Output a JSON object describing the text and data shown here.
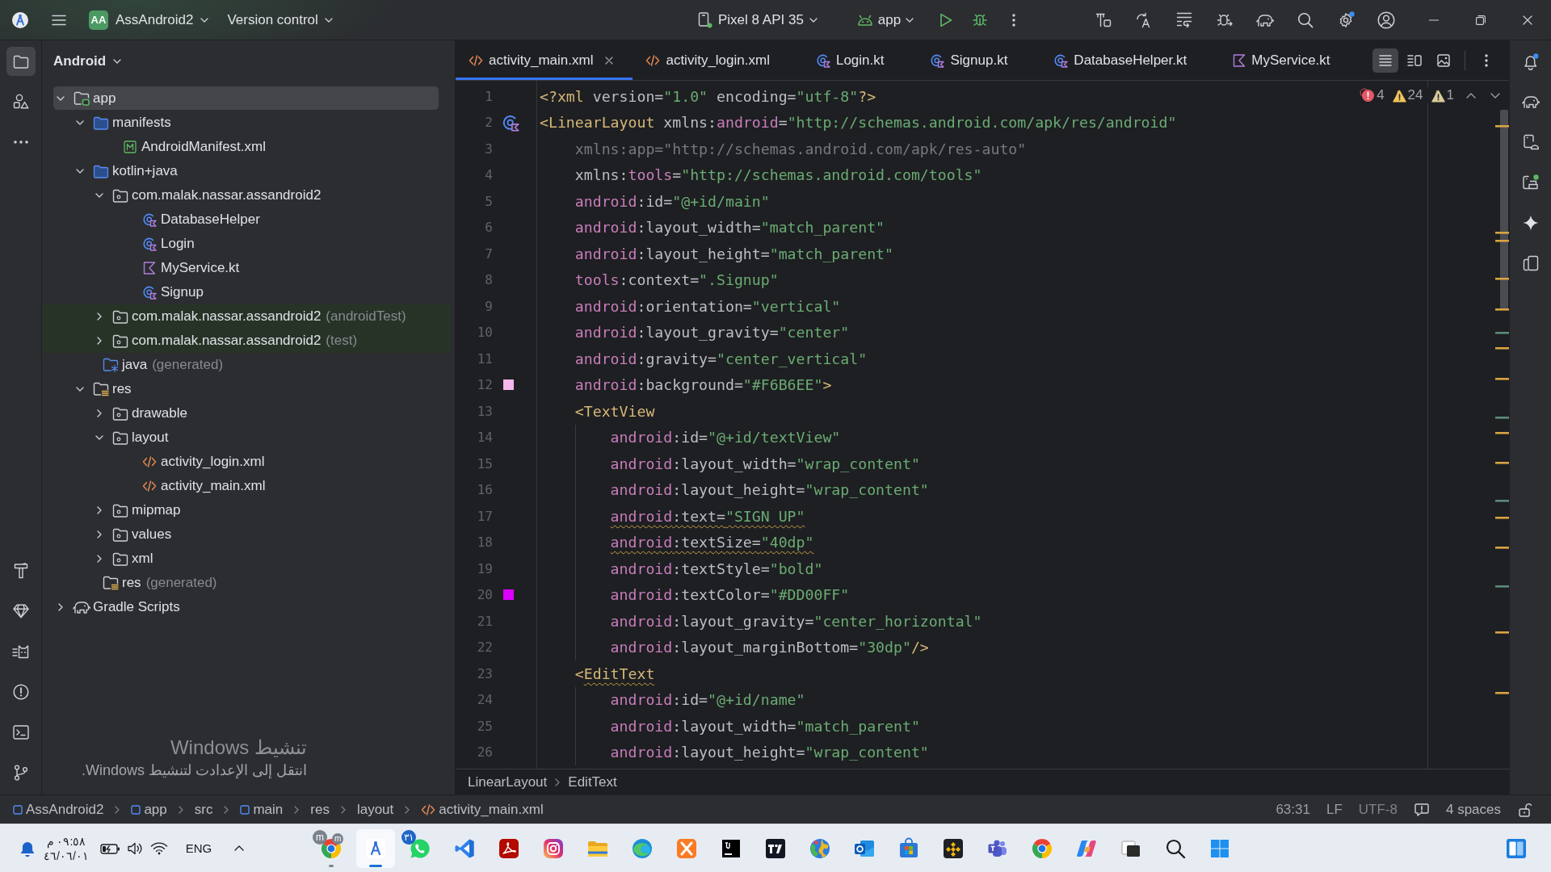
{
  "toolbar": {
    "project_badge": "AA",
    "project": "AssAndroid2",
    "vcs": "Version control",
    "device": "Pixel 8 API 35",
    "run_config": "app"
  },
  "tool_window": {
    "title": "Android"
  },
  "project_tree": [
    {
      "label": "app",
      "kind": "module",
      "expanded": true,
      "selected": true,
      "children": [
        {
          "label": "manifests",
          "kind": "folder",
          "expanded": true,
          "selected": false,
          "children": [
            {
              "label": "AndroidManifest.xml",
              "kind": "manifest",
              "selected": false
            }
          ]
        },
        {
          "label": "kotlin+java",
          "kind": "folder",
          "expanded": true,
          "selected": false,
          "children": [
            {
              "label": "com.malak.nassar.assandroid2",
              "kind": "package",
              "expanded": true,
              "selected": false,
              "children": [
                {
                  "label": "DatabaseHelper",
                  "kind": "class",
                  "selected": false
                },
                {
                  "label": "Login",
                  "kind": "class",
                  "selected": false
                },
                {
                  "label": "MyService.kt",
                  "kind": "kotlin",
                  "selected": false
                },
                {
                  "label": "Signup",
                  "kind": "class",
                  "selected": false
                }
              ]
            },
            {
              "label": "com.malak.nassar.assandroid2",
              "suffix": "(androidTest)",
              "kind": "test-package",
              "expanded": false,
              "selected": false
            },
            {
              "label": "com.malak.nassar.assandroid2",
              "suffix": "(test)",
              "kind": "test-package",
              "expanded": false,
              "selected": false
            }
          ]
        },
        {
          "label": "java",
          "suffix": "(generated)",
          "kind": "generated",
          "selected": false
        },
        {
          "label": "res",
          "kind": "resources",
          "expanded": true,
          "selected": false,
          "children": [
            {
              "label": "drawable",
              "kind": "package",
              "expanded": false,
              "selected": false
            },
            {
              "label": "layout",
              "kind": "package",
              "expanded": true,
              "selected": false,
              "children": [
                {
                  "label": "activity_login.xml",
                  "kind": "layout",
                  "selected": false
                },
                {
                  "label": "activity_main.xml",
                  "kind": "layout",
                  "selected": false
                }
              ]
            },
            {
              "label": "mipmap",
              "kind": "package",
              "expanded": false,
              "selected": false
            },
            {
              "label": "values",
              "kind": "package",
              "expanded": false,
              "selected": false
            },
            {
              "label": "xml",
              "kind": "package",
              "expanded": false,
              "selected": false
            }
          ]
        },
        {
          "label": "res",
          "suffix": "(generated)",
          "kind": "resources",
          "selected": false
        }
      ]
    },
    {
      "label": "Gradle Scripts",
      "kind": "gradle",
      "expanded": false,
      "selected": false
    }
  ],
  "editor_tabs": [
    {
      "label": "activity_main.xml",
      "kind": "xml",
      "selected": true
    },
    {
      "label": "activity_login.xml",
      "kind": "xml",
      "selected": false
    },
    {
      "label": "Login.kt",
      "kind": "class",
      "selected": false
    },
    {
      "label": "Signup.kt",
      "kind": "class",
      "selected": false
    },
    {
      "label": "DatabaseHelper.kt",
      "kind": "class",
      "selected": false
    },
    {
      "label": "MyService.kt",
      "kind": "kotlin",
      "selected": false
    }
  ],
  "view_modes": [
    {
      "kind": "code",
      "selected": true
    },
    {
      "kind": "split",
      "selected": false
    },
    {
      "kind": "design",
      "selected": false
    }
  ],
  "inspections": [
    {
      "kind": "error",
      "count": "4"
    },
    {
      "kind": "warning",
      "count": "24"
    },
    {
      "kind": "weak",
      "count": "1"
    }
  ],
  "code_lines": [
    {
      "number": "1",
      "warning": false,
      "tokens": [
        {
          "kind": "tag",
          "text": "<?xml"
        },
        {
          "kind": "attr",
          "text": " version="
        },
        {
          "kind": "value",
          "text": "\"1.0\""
        },
        {
          "kind": "attr",
          "text": " encoding="
        },
        {
          "kind": "value",
          "text": "\"utf-8\""
        },
        {
          "kind": "tag",
          "text": "?>"
        }
      ]
    },
    {
      "number": "2",
      "warning": false,
      "gutter_icon": true,
      "tokens": [
        {
          "kind": "tag",
          "text": "<LinearLayout"
        },
        {
          "kind": "attr",
          "text": " xmlns:"
        },
        {
          "kind": "ns",
          "text": "android"
        },
        {
          "kind": "attr",
          "text": "="
        },
        {
          "kind": "value",
          "text": "\"http://schemas.android.com/apk/res/android\""
        }
      ],
      "children": [
        {
          "number": "3",
          "warning": false,
          "tokens": [
            {
              "kind": "unused",
              "text": "xmlns:app=\"http://schemas.android.com/apk/res-auto\""
            }
          ]
        },
        {
          "number": "4",
          "warning": false,
          "tokens": [
            {
              "kind": "attr",
              "text": "xmlns:"
            },
            {
              "kind": "ns",
              "text": "tools"
            },
            {
              "kind": "attr",
              "text": "="
            },
            {
              "kind": "value",
              "text": "\"http://schemas.android.com/tools\""
            }
          ]
        },
        {
          "number": "5",
          "warning": false,
          "tokens": [
            {
              "kind": "ns",
              "text": "android"
            },
            {
              "kind": "attr",
              "text": ":id="
            },
            {
              "kind": "value",
              "text": "\"@+id/main\""
            }
          ]
        },
        {
          "number": "6",
          "warning": false,
          "tokens": [
            {
              "kind": "ns",
              "text": "android"
            },
            {
              "kind": "attr",
              "text": ":layout_width="
            },
            {
              "kind": "value",
              "text": "\"match_parent\""
            }
          ]
        },
        {
          "number": "7",
          "warning": false,
          "tokens": [
            {
              "kind": "ns",
              "text": "android"
            },
            {
              "kind": "attr",
              "text": ":layout_height="
            },
            {
              "kind": "value",
              "text": "\"match_parent\""
            }
          ]
        },
        {
          "number": "8",
          "warning": false,
          "tokens": [
            {
              "kind": "ns",
              "text": "tools"
            },
            {
              "kind": "attr",
              "text": ":context="
            },
            {
              "kind": "value",
              "text": "\".Signup\""
            }
          ]
        },
        {
          "number": "9",
          "warning": false,
          "tokens": [
            {
              "kind": "ns",
              "text": "android"
            },
            {
              "kind": "attr",
              "text": ":orientation="
            },
            {
              "kind": "value",
              "text": "\"vertical\""
            }
          ]
        },
        {
          "number": "10",
          "warning": false,
          "tokens": [
            {
              "kind": "ns",
              "text": "android"
            },
            {
              "kind": "attr",
              "text": ":layout_gravity="
            },
            {
              "kind": "value",
              "text": "\"center\""
            }
          ]
        },
        {
          "number": "11",
          "warning": false,
          "tokens": [
            {
              "kind": "ns",
              "text": "android"
            },
            {
              "kind": "attr",
              "text": ":gravity="
            },
            {
              "kind": "value",
              "text": "\"center_vertical\""
            }
          ]
        },
        {
          "number": "12",
          "warning": false,
          "color": "#F6B6EE",
          "tokens": [
            {
              "kind": "ns",
              "text": "android"
            },
            {
              "kind": "attr",
              "text": ":background="
            },
            {
              "kind": "value",
              "text": "\"#F6B6EE\""
            },
            {
              "kind": "tag",
              "text": ">"
            }
          ]
        },
        {
          "number": "13",
          "warning": false,
          "tokens": [
            {
              "kind": "tag",
              "text": "<TextView"
            }
          ],
          "children": [
            {
              "number": "14",
              "warning": false,
              "tokens": [
                {
                  "kind": "ns",
                  "text": "android"
                },
                {
                  "kind": "attr",
                  "text": ":id="
                },
                {
                  "kind": "value",
                  "text": "\"@+id/textView\""
                }
              ]
            },
            {
              "number": "15",
              "warning": false,
              "tokens": [
                {
                  "kind": "ns",
                  "text": "android"
                },
                {
                  "kind": "attr",
                  "text": ":layout_width="
                },
                {
                  "kind": "value",
                  "text": "\"wrap_content\""
                }
              ]
            },
            {
              "number": "16",
              "warning": false,
              "tokens": [
                {
                  "kind": "ns",
                  "text": "android"
                },
                {
                  "kind": "attr",
                  "text": ":layout_height="
                },
                {
                  "kind": "value",
                  "text": "\"wrap_content\""
                }
              ]
            },
            {
              "number": "17",
              "warning": true,
              "tokens": [
                {
                  "kind": "ns",
                  "text": "android"
                },
                {
                  "kind": "attr",
                  "text": ":text="
                },
                {
                  "kind": "value",
                  "text": "\"SIGN UP\""
                }
              ]
            },
            {
              "number": "18",
              "warning": true,
              "tokens": [
                {
                  "kind": "ns",
                  "text": "android"
                },
                {
                  "kind": "attr",
                  "text": ":textSize="
                },
                {
                  "kind": "value",
                  "text": "\"40dp\""
                }
              ]
            },
            {
              "number": "19",
              "warning": false,
              "tokens": [
                {
                  "kind": "ns",
                  "text": "android"
                },
                {
                  "kind": "attr",
                  "text": ":textStyle="
                },
                {
                  "kind": "value",
                  "text": "\"bold\""
                }
              ]
            },
            {
              "number": "20",
              "warning": false,
              "color": "#DD00FF",
              "tokens": [
                {
                  "kind": "ns",
                  "text": "android"
                },
                {
                  "kind": "attr",
                  "text": ":textColor="
                },
                {
                  "kind": "value",
                  "text": "\"#DD00FF\""
                }
              ]
            },
            {
              "number": "21",
              "warning": false,
              "tokens": [
                {
                  "kind": "ns",
                  "text": "android"
                },
                {
                  "kind": "attr",
                  "text": ":layout_gravity="
                },
                {
                  "kind": "value",
                  "text": "\"center_horizontal\""
                }
              ]
            },
            {
              "number": "22",
              "warning": false,
              "tokens": [
                {
                  "kind": "ns",
                  "text": "android"
                },
                {
                  "kind": "attr",
                  "text": ":layout_marginBottom="
                },
                {
                  "kind": "value",
                  "text": "\"30dp\""
                },
                {
                  "kind": "tag",
                  "text": "/>"
                }
              ]
            }
          ]
        },
        {
          "number": "23",
          "warning": true,
          "tokens": [
            {
              "kind": "bracket",
              "text": "<"
            },
            {
              "kind": "tag",
              "text": "EditText"
            }
          ],
          "children": [
            {
              "number": "24",
              "warning": false,
              "tokens": [
                {
                  "kind": "ns",
                  "text": "android"
                },
                {
                  "kind": "attr",
                  "text": ":id="
                },
                {
                  "kind": "value",
                  "text": "\"@+id/name\""
                }
              ]
            },
            {
              "number": "25",
              "warning": false,
              "tokens": [
                {
                  "kind": "ns",
                  "text": "android"
                },
                {
                  "kind": "attr",
                  "text": ":layout_width="
                },
                {
                  "kind": "value",
                  "text": "\"match_parent\""
                }
              ]
            },
            {
              "number": "26",
              "warning": false,
              "tokens": [
                {
                  "kind": "ns",
                  "text": "android"
                },
                {
                  "kind": "attr",
                  "text": ":layout_height="
                },
                {
                  "kind": "value",
                  "text": "\"wrap_content\""
                }
              ]
            }
          ]
        }
      ]
    }
  ],
  "breadcrumbs": [
    "LinearLayout",
    "EditText"
  ],
  "status_bar": {
    "path": [
      {
        "label": "AssAndroid2",
        "kind": "module"
      },
      {
        "label": "app",
        "kind": "module"
      },
      {
        "label": "src",
        "kind": "plain"
      },
      {
        "label": "main",
        "kind": "module"
      },
      {
        "label": "res",
        "kind": "plain"
      },
      {
        "label": "layout",
        "kind": "plain"
      },
      {
        "label": "activity_main.xml",
        "kind": "xml"
      }
    ],
    "position": "63:31",
    "line_separator": "LF",
    "encoding": "UTF-8",
    "indent": "4 spaces"
  },
  "activation_notice": {
    "title": "تنشيط Windows",
    "message": "انتقل إلى الإعدادت لتنشيط Windows."
  },
  "taskbar": {
    "time": "٠٩:٥٨ م",
    "date": "٤٦/٠٦/٠١",
    "language": "ENG",
    "apps": [
      {
        "kind": "ring",
        "badges": [
          {
            "text": "m",
            "color": "#7A828C"
          },
          {
            "text": "m",
            "color": "#7A828C"
          }
        ],
        "active": false,
        "running": true
      },
      {
        "kind": "compass",
        "active": true,
        "running": true
      },
      {
        "kind": "chat",
        "badges": [
          {
            "text": "٣١",
            "color": "#1F66C6"
          }
        ],
        "active": false,
        "running": false
      },
      {
        "kind": "ribbon",
        "active": false,
        "running": false
      },
      {
        "kind": "loop-tile",
        "active": false,
        "running": false
      },
      {
        "kind": "camera",
        "active": false,
        "running": false
      },
      {
        "kind": "folder",
        "active": false,
        "running": false
      },
      {
        "kind": "wave",
        "active": false,
        "running": false
      },
      {
        "kind": "cross-tile",
        "active": false,
        "running": false
      },
      {
        "kind": "bar-tile",
        "active": false,
        "running": false
      },
      {
        "kind": "shape-tile",
        "active": false,
        "running": false
      },
      {
        "kind": "globe",
        "active": false,
        "running": false
      },
      {
        "kind": "envelope",
        "active": false,
        "running": false
      },
      {
        "kind": "bag",
        "active": false,
        "running": false
      },
      {
        "kind": "diamond",
        "active": false,
        "running": false
      },
      {
        "kind": "people",
        "active": false,
        "running": false
      },
      {
        "kind": "ring",
        "active": false,
        "running": false
      },
      {
        "kind": "swirl",
        "active": false,
        "running": false
      },
      {
        "kind": "squares",
        "active": false,
        "running": false
      },
      {
        "kind": "search",
        "active": false,
        "running": false
      },
      {
        "kind": "tiles",
        "active": false,
        "running": false
      }
    ]
  }
}
